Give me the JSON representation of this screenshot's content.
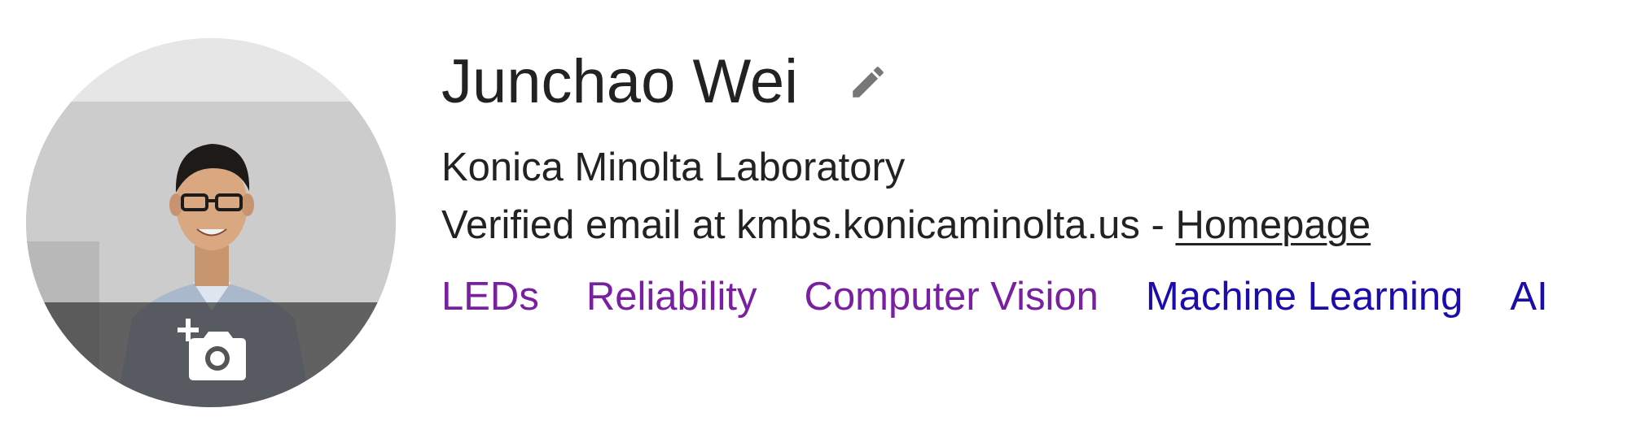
{
  "profile": {
    "name": "Junchao Wei",
    "affiliation": "Konica Minolta Laboratory",
    "email_text": "Verified email at kmbs.konicaminolta.us - ",
    "homepage_label": "Homepage"
  },
  "interests": [
    {
      "label": "LEDs",
      "color": "#7a1fa2"
    },
    {
      "label": "Reliability",
      "color": "#7a1fa2"
    },
    {
      "label": "Computer Vision",
      "color": "#7a1fa2"
    },
    {
      "label": "Machine Learning",
      "color": "#1a0dab"
    },
    {
      "label": "AI",
      "color": "#1a0dab"
    }
  ],
  "icons": {
    "edit": "pencil-icon",
    "add_photo": "add-photo-camera-icon"
  },
  "colors": {
    "visited_link": "#7a1fa2",
    "link": "#1a0dab",
    "text": "#222222",
    "icon": "#777777"
  }
}
